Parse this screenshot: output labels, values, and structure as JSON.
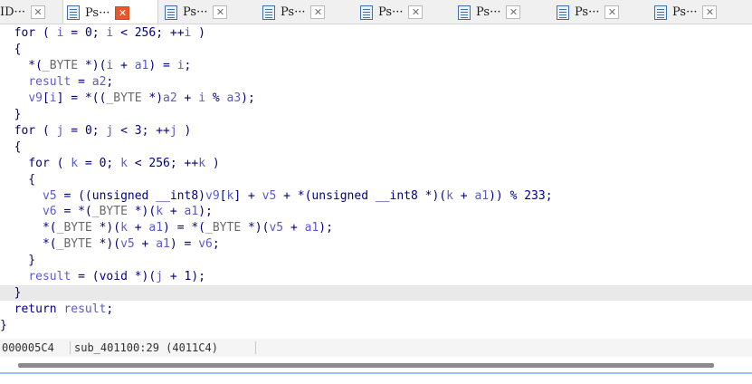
{
  "tabs": [
    {
      "label": "ID···",
      "active": false
    },
    {
      "label": "Ps···",
      "active": true
    },
    {
      "label": "Ps···",
      "active": false
    },
    {
      "label": "Ps···",
      "active": false
    },
    {
      "label": "Ps···",
      "active": false
    },
    {
      "label": "Ps···",
      "active": false
    },
    {
      "label": "Ps···",
      "active": false
    },
    {
      "label": "Ps···",
      "active": false
    }
  ],
  "close_glyph": "✕",
  "code_lines": [
    {
      "highlight": false,
      "tokens": [
        [
          "  ",
          "p"
        ],
        [
          "for",
          "k"
        ],
        [
          " ( ",
          "p"
        ],
        [
          "i",
          "v"
        ],
        [
          " = ",
          "p"
        ],
        [
          "0",
          "n"
        ],
        [
          "; ",
          "p"
        ],
        [
          "i",
          "v"
        ],
        [
          " < ",
          "p"
        ],
        [
          "256",
          "n"
        ],
        [
          "; ++",
          "p"
        ],
        [
          "i",
          "v"
        ],
        [
          " )",
          "p"
        ]
      ]
    },
    {
      "highlight": false,
      "tokens": [
        [
          "  {",
          "p"
        ]
      ]
    },
    {
      "highlight": false,
      "tokens": [
        [
          "    *(",
          "p"
        ],
        [
          "_BYTE",
          "c"
        ],
        [
          " *)(",
          "p"
        ],
        [
          "i",
          "v"
        ],
        [
          " + ",
          "p"
        ],
        [
          "a1",
          "v"
        ],
        [
          ") = ",
          "p"
        ],
        [
          "i",
          "v"
        ],
        [
          ";",
          "p"
        ]
      ]
    },
    {
      "highlight": false,
      "tokens": [
        [
          "    ",
          "p"
        ],
        [
          "result",
          "v"
        ],
        [
          " = ",
          "p"
        ],
        [
          "a2",
          "v"
        ],
        [
          ";",
          "p"
        ]
      ]
    },
    {
      "highlight": false,
      "tokens": [
        [
          "    ",
          "p"
        ],
        [
          "v9",
          "v"
        ],
        [
          "[",
          "p"
        ],
        [
          "i",
          "v"
        ],
        [
          "] = *((",
          "p"
        ],
        [
          "_BYTE",
          "c"
        ],
        [
          " *)",
          "p"
        ],
        [
          "a2",
          "v"
        ],
        [
          " + ",
          "p"
        ],
        [
          "i",
          "v"
        ],
        [
          " % ",
          "p"
        ],
        [
          "a3",
          "v"
        ],
        [
          ");",
          "p"
        ]
      ]
    },
    {
      "highlight": false,
      "tokens": [
        [
          "  }",
          "p"
        ]
      ]
    },
    {
      "highlight": false,
      "tokens": [
        [
          "  ",
          "p"
        ],
        [
          "for",
          "k"
        ],
        [
          " ( ",
          "p"
        ],
        [
          "j",
          "v"
        ],
        [
          " = ",
          "p"
        ],
        [
          "0",
          "n"
        ],
        [
          "; ",
          "p"
        ],
        [
          "j",
          "v"
        ],
        [
          " < ",
          "p"
        ],
        [
          "3",
          "n"
        ],
        [
          "; ++",
          "p"
        ],
        [
          "j",
          "v"
        ],
        [
          " )",
          "p"
        ]
      ]
    },
    {
      "highlight": false,
      "tokens": [
        [
          "  {",
          "p"
        ]
      ]
    },
    {
      "highlight": false,
      "tokens": [
        [
          "    ",
          "p"
        ],
        [
          "for",
          "k"
        ],
        [
          " ( ",
          "p"
        ],
        [
          "k",
          "v"
        ],
        [
          " = ",
          "p"
        ],
        [
          "0",
          "n"
        ],
        [
          "; ",
          "p"
        ],
        [
          "k",
          "v"
        ],
        [
          " < ",
          "p"
        ],
        [
          "256",
          "n"
        ],
        [
          "; ++",
          "p"
        ],
        [
          "k",
          "v"
        ],
        [
          " )",
          "p"
        ]
      ]
    },
    {
      "highlight": false,
      "tokens": [
        [
          "    {",
          "p"
        ]
      ]
    },
    {
      "highlight": false,
      "tokens": [
        [
          "      ",
          "p"
        ],
        [
          "v5",
          "v"
        ],
        [
          " = ((unsigned __int8)",
          "p"
        ],
        [
          "v9",
          "v"
        ],
        [
          "[",
          "p"
        ],
        [
          "k",
          "v"
        ],
        [
          "] + ",
          "p"
        ],
        [
          "v5",
          "v"
        ],
        [
          " + *(unsigned __int8 *)(",
          "p"
        ],
        [
          "k",
          "v"
        ],
        [
          " + ",
          "p"
        ],
        [
          "a1",
          "v"
        ],
        [
          ")) % ",
          "p"
        ],
        [
          "233",
          "n"
        ],
        [
          ";",
          "p"
        ]
      ]
    },
    {
      "highlight": false,
      "tokens": [
        [
          "      ",
          "p"
        ],
        [
          "v6",
          "v"
        ],
        [
          " = *(",
          "p"
        ],
        [
          "_BYTE",
          "c"
        ],
        [
          " *)(",
          "p"
        ],
        [
          "k",
          "v"
        ],
        [
          " + ",
          "p"
        ],
        [
          "a1",
          "v"
        ],
        [
          ");",
          "p"
        ]
      ]
    },
    {
      "highlight": false,
      "tokens": [
        [
          "      *(",
          "p"
        ],
        [
          "_BYTE",
          "c"
        ],
        [
          " *)(",
          "p"
        ],
        [
          "k",
          "v"
        ],
        [
          " + ",
          "p"
        ],
        [
          "a1",
          "v"
        ],
        [
          ") = *(",
          "p"
        ],
        [
          "_BYTE",
          "c"
        ],
        [
          " *)(",
          "p"
        ],
        [
          "v5",
          "v"
        ],
        [
          " + ",
          "p"
        ],
        [
          "a1",
          "v"
        ],
        [
          ");",
          "p"
        ]
      ]
    },
    {
      "highlight": false,
      "tokens": [
        [
          "      *(",
          "p"
        ],
        [
          "_BYTE",
          "c"
        ],
        [
          " *)(",
          "p"
        ],
        [
          "v5",
          "v"
        ],
        [
          " + ",
          "p"
        ],
        [
          "a1",
          "v"
        ],
        [
          ") = ",
          "p"
        ],
        [
          "v6",
          "v"
        ],
        [
          ";",
          "p"
        ]
      ]
    },
    {
      "highlight": false,
      "tokens": [
        [
          "    }",
          "p"
        ]
      ]
    },
    {
      "highlight": false,
      "tokens": [
        [
          "    ",
          "p"
        ],
        [
          "result",
          "v"
        ],
        [
          " = (void *)(",
          "p"
        ],
        [
          "j",
          "v"
        ],
        [
          " + ",
          "p"
        ],
        [
          "1",
          "n"
        ],
        [
          ");",
          "p"
        ]
      ]
    },
    {
      "highlight": true,
      "tokens": [
        [
          "  }",
          "p"
        ]
      ]
    },
    {
      "highlight": false,
      "tokens": [
        [
          "  ",
          "p"
        ],
        [
          "return",
          "k"
        ],
        [
          " ",
          "p"
        ],
        [
          "result",
          "v"
        ],
        [
          ";",
          "p"
        ]
      ]
    },
    {
      "highlight": false,
      "tokens": [
        [
          "}",
          "p"
        ]
      ]
    }
  ],
  "status": {
    "address": "000005C4",
    "location": "sub_401100:29 (4011C4)"
  },
  "colors": {
    "keyword": "#000080",
    "variable": "#5a5ac8",
    "cast_type": "#6a6a6a",
    "highlight_line": "#e9e9e9",
    "active_close": "#e8562a"
  }
}
